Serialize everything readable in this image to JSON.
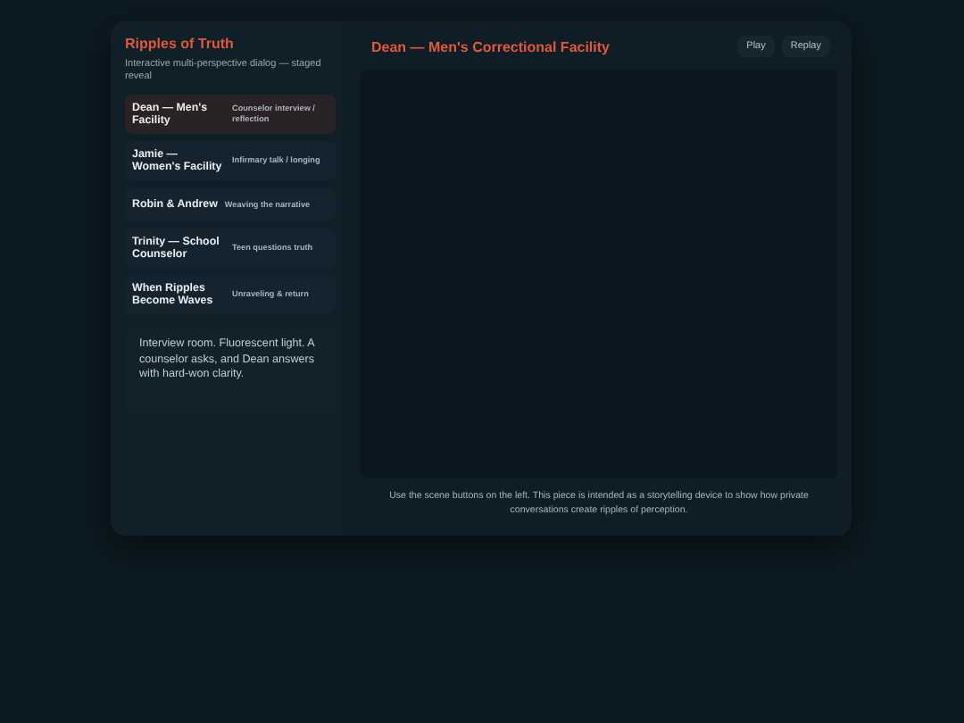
{
  "sidebar": {
    "title": "Ripples of Truth",
    "subtitle": "Interactive multi-perspective dialog — staged reveal",
    "scenes": [
      {
        "name": "Dean — Men's Facility",
        "note": "Counselor interview / reflection",
        "selected": true
      },
      {
        "name": "Jamie — Women's Facility",
        "note": "Infirmary talk / longing",
        "selected": false
      },
      {
        "name": "Robin & Andrew",
        "note": "Weaving the narrative",
        "selected": false
      },
      {
        "name": "Trinity — School Counselor",
        "note": "Teen questions truth",
        "selected": false
      },
      {
        "name": "When Ripples Become Waves",
        "note": "Unraveling & return",
        "selected": false
      }
    ],
    "description": "Interview room. Fluorescent light. A counselor asks, and Dean answers with hard-won clarity."
  },
  "main": {
    "title": "Dean — Men's Correctional Facility",
    "buttons": [
      "Play",
      "Replay"
    ],
    "footer": "Use the scene buttons on the left. This piece is intended as a storytelling device to show how private conversations create ripples of perception."
  }
}
